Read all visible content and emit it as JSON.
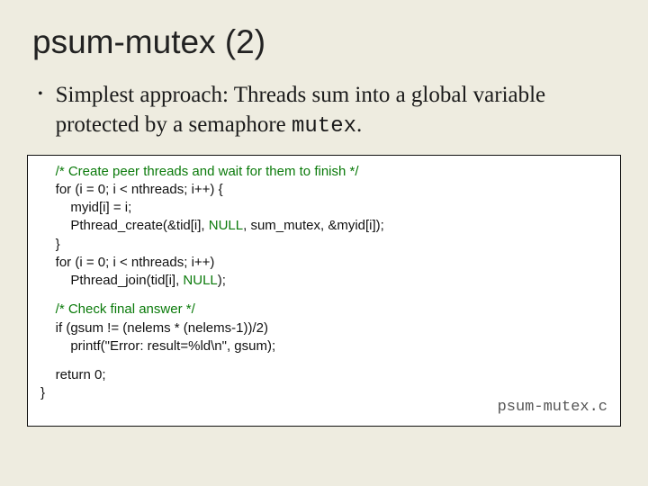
{
  "title": "psum-mutex (2)",
  "bullet": {
    "dot": "•",
    "text_before": "Simplest approach: Threads sum into a global variable protected by a semaphore ",
    "mono": "mutex",
    "text_after": "."
  },
  "code": {
    "c1": "    /* Create peer threads and wait for them to finish */",
    "l1": "    for (i = 0; i < nthreads; i++) {",
    "l2": "        myid[i] = i;",
    "l3a": "        Pthread_create(&tid[i], ",
    "l3b": "NULL",
    "l3c": ", sum_mutex, &myid[i]);",
    "l4": "    }",
    "l5": "    for (i = 0; i < nthreads; i++)",
    "l6a": "        Pthread_join(tid[i], ",
    "l6b": "NULL",
    "l6c": ");",
    "c2": "    /* Check final answer */",
    "l7": "    if (gsum != (nelems * (nelems-1))/2)",
    "l8": "        printf(\"Error: result=%ld\\n\", gsum);",
    "l9": "    return 0;",
    "l10": "}"
  },
  "file_label": "psum-mutex.c"
}
